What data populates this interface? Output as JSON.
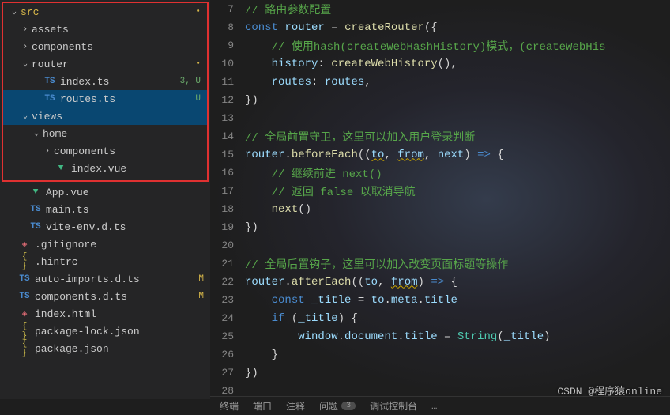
{
  "sidebar": {
    "boxed": [
      {
        "type": "folder",
        "name": "src",
        "indent": 0,
        "open": true,
        "mark": "dot-yellow",
        "highlight": "src"
      },
      {
        "type": "folder",
        "name": "assets",
        "indent": 1,
        "open": false
      },
      {
        "type": "folder",
        "name": "components",
        "indent": 1,
        "open": false
      },
      {
        "type": "folder",
        "name": "router",
        "indent": 1,
        "open": true,
        "mark": "dot-yellow"
      },
      {
        "type": "file",
        "name": "index.ts",
        "indent": 2,
        "icon": "ts",
        "status": "3, U",
        "statusClass": "u"
      },
      {
        "type": "file",
        "name": "routes.ts",
        "indent": 2,
        "icon": "ts",
        "status": "U",
        "statusClass": "u",
        "selected": true
      },
      {
        "type": "folder",
        "name": "views",
        "indent": 1,
        "open": true,
        "selected": "blue"
      },
      {
        "type": "folder",
        "name": "home",
        "indent": 2,
        "open": true
      },
      {
        "type": "folder",
        "name": "components",
        "indent": 3,
        "open": false
      },
      {
        "type": "file",
        "name": "index.vue",
        "indent": 3,
        "icon": "vue"
      }
    ],
    "rest": [
      {
        "type": "file",
        "name": "App.vue",
        "indent": 1,
        "icon": "vue"
      },
      {
        "type": "file",
        "name": "main.ts",
        "indent": 1,
        "icon": "ts"
      },
      {
        "type": "file",
        "name": "vite-env.d.ts",
        "indent": 1,
        "icon": "ts"
      },
      {
        "type": "file",
        "name": ".gitignore",
        "indent": 0,
        "icon": "diamond"
      },
      {
        "type": "file",
        "name": ".hintrc",
        "indent": 0,
        "icon": "curly"
      },
      {
        "type": "file",
        "name": "auto-imports.d.ts",
        "indent": 0,
        "icon": "ts",
        "status": "M",
        "statusClass": "m"
      },
      {
        "type": "file",
        "name": "components.d.ts",
        "indent": 0,
        "icon": "ts",
        "status": "M",
        "statusClass": "m"
      },
      {
        "type": "file",
        "name": "index.html",
        "indent": 0,
        "icon": "diamond"
      },
      {
        "type": "file",
        "name": "package-lock.json",
        "indent": 0,
        "icon": "curly"
      },
      {
        "type": "file",
        "name": "package.json",
        "indent": 0,
        "icon": "curly"
      }
    ]
  },
  "editor": {
    "startLine": 7,
    "lines": [
      [
        [
          "c-comment",
          "// 路由参数配置"
        ]
      ],
      [
        [
          "c-keyword",
          "const"
        ],
        [
          "c-punc",
          " "
        ],
        [
          "c-var",
          "router"
        ],
        [
          "c-punc",
          " = "
        ],
        [
          "c-func",
          "createRouter"
        ],
        [
          "c-punc",
          "({"
        ]
      ],
      [
        [
          "c-dim",
          "    "
        ],
        [
          "c-comment",
          "// 使用hash(createWebHashHistory)模式，(createWebHis"
        ]
      ],
      [
        [
          "c-dim",
          "    "
        ],
        [
          "c-prop",
          "history"
        ],
        [
          "c-punc",
          ": "
        ],
        [
          "c-func",
          "createWebHistory"
        ],
        [
          "c-punc",
          "(),"
        ]
      ],
      [
        [
          "c-dim",
          "    "
        ],
        [
          "c-prop",
          "routes"
        ],
        [
          "c-punc",
          ": "
        ],
        [
          "c-var",
          "routes"
        ],
        [
          "c-punc",
          ","
        ]
      ],
      [
        [
          "c-punc",
          "})"
        ]
      ],
      [
        [
          "",
          ""
        ]
      ],
      [
        [
          "c-comment",
          "// 全局前置守卫，这里可以加入用户登录判断"
        ]
      ],
      [
        [
          "c-var",
          "router"
        ],
        [
          "c-punc",
          "."
        ],
        [
          "c-func",
          "beforeEach"
        ],
        [
          "c-punc",
          "(("
        ],
        [
          "c-var wavy",
          "to"
        ],
        [
          "c-punc",
          ", "
        ],
        [
          "c-var wavy",
          "from"
        ],
        [
          "c-punc",
          ", "
        ],
        [
          "c-var",
          "next"
        ],
        [
          "c-punc",
          ") "
        ],
        [
          "c-arrow",
          "=>"
        ],
        [
          "c-punc",
          " {"
        ]
      ],
      [
        [
          "c-dim",
          "    "
        ],
        [
          "c-comment",
          "// 继续前进 next()"
        ]
      ],
      [
        [
          "c-dim",
          "    "
        ],
        [
          "c-comment",
          "// 返回 false 以取消导航"
        ]
      ],
      [
        [
          "c-dim",
          "    "
        ],
        [
          "c-func",
          "next"
        ],
        [
          "c-punc",
          "()"
        ]
      ],
      [
        [
          "c-punc",
          "})"
        ]
      ],
      [
        [
          "",
          ""
        ]
      ],
      [
        [
          "c-comment",
          "// 全局后置钩子，这里可以加入改变页面标题等操作"
        ]
      ],
      [
        [
          "c-var",
          "router"
        ],
        [
          "c-punc",
          "."
        ],
        [
          "c-func",
          "afterEach"
        ],
        [
          "c-punc",
          "(("
        ],
        [
          "c-var",
          "to"
        ],
        [
          "c-punc",
          ", "
        ],
        [
          "c-var wavy",
          "from"
        ],
        [
          "c-punc",
          ") "
        ],
        [
          "c-arrow",
          "=>"
        ],
        [
          "c-punc",
          " {"
        ]
      ],
      [
        [
          "c-dim",
          "    "
        ],
        [
          "c-keyword",
          "const"
        ],
        [
          "c-punc",
          " "
        ],
        [
          "c-var",
          "_title"
        ],
        [
          "c-punc",
          " = "
        ],
        [
          "c-var",
          "to"
        ],
        [
          "c-punc",
          "."
        ],
        [
          "c-prop",
          "meta"
        ],
        [
          "c-punc",
          "."
        ],
        [
          "c-prop",
          "title"
        ]
      ],
      [
        [
          "c-dim",
          "    "
        ],
        [
          "c-keyword",
          "if"
        ],
        [
          "c-punc",
          " ("
        ],
        [
          "c-var",
          "_title"
        ],
        [
          "c-punc",
          ") {"
        ]
      ],
      [
        [
          "c-dim",
          "        "
        ],
        [
          "c-var",
          "window"
        ],
        [
          "c-punc",
          "."
        ],
        [
          "c-var",
          "document"
        ],
        [
          "c-punc",
          "."
        ],
        [
          "c-prop",
          "title"
        ],
        [
          "c-punc",
          " = "
        ],
        [
          "c-type",
          "String"
        ],
        [
          "c-punc",
          "("
        ],
        [
          "c-var",
          "_title"
        ],
        [
          "c-punc",
          ")"
        ]
      ],
      [
        [
          "c-dim",
          "    "
        ],
        [
          "c-punc",
          "}"
        ]
      ],
      [
        [
          "c-punc",
          "})"
        ]
      ],
      [
        [
          "",
          ""
        ]
      ]
    ]
  },
  "bottomTabs": {
    "terminal": "终端",
    "port": "端口",
    "comment": "注释",
    "problems": "问题",
    "problemsCount": "3",
    "debugConsole": "调试控制台",
    "ellipsis": "…"
  },
  "watermark": "CSDN @程序猿online"
}
